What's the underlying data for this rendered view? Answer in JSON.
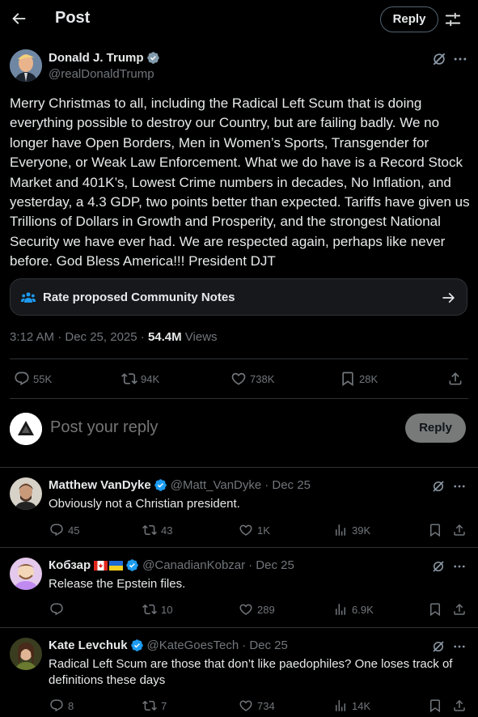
{
  "header": {
    "title": "Post",
    "reply_label": "Reply"
  },
  "post": {
    "author_name": "Donald J. Trump",
    "author_handle": "@realDonaldTrump",
    "text": "Merry Christmas to all, including the Radical Left Scum that is doing everything possible to destroy our Country, but are failing badly. We no longer have Open Borders, Men in Women’s Sports, Transgender for Everyone, or Weak Law Enforcement. What we do have is a Record Stock Market and 401K’s, Lowest Crime numbers in decades, No Inflation, and yesterday, a 4.3 GDP, two points better than expected. Tariffs have given us Trillions of Dollars in Growth and Prosperity, and the strongest National Security we have ever had. We are respected again, perhaps like never before. God Bless America!!! President DJT",
    "community_notes_label": "Rate proposed Community Notes",
    "time": "3:12 AM · Dec 25, 2025 · ",
    "views_count": "54.4M",
    "views_label": " Views",
    "stats": {
      "replies": "55K",
      "reposts": "94K",
      "likes": "738K",
      "bookmarks": "28K"
    },
    "accent_color": "#1d9bf0"
  },
  "compose": {
    "placeholder": "Post your reply",
    "reply_label": "Reply"
  },
  "replies": [
    {
      "name": "Matthew VanDyke",
      "handle": "@Matt_VanDyke",
      "date": "· Dec 25",
      "text": "Obviously not a Christian president.",
      "replies": "45",
      "reposts": "43",
      "likes": "1K",
      "views": "39K"
    },
    {
      "name": "Кобзар",
      "handle": "@CanadianKobzar",
      "date": "· Dec 25",
      "text": "Release the Epstein files.",
      "replies": "",
      "reposts": "10",
      "likes": "289",
      "views": "6.9K"
    },
    {
      "name": "Kate Levchuk",
      "handle": "@KateGoesTech",
      "date": "· Dec 25",
      "text": "Radical Left Scum are those that don’t like paedophiles? One loses track of definitions these days",
      "replies": "8",
      "reposts": "7",
      "likes": "734",
      "views": "14K"
    }
  ],
  "icons": [
    "back-arrow-icon",
    "filter-icon",
    "verified-icon",
    "grok-icon",
    "more-icon",
    "community-notes-icon",
    "arrow-right-icon",
    "reply-icon",
    "repost-icon",
    "like-icon",
    "bookmark-icon",
    "share-icon",
    "views-icon"
  ]
}
